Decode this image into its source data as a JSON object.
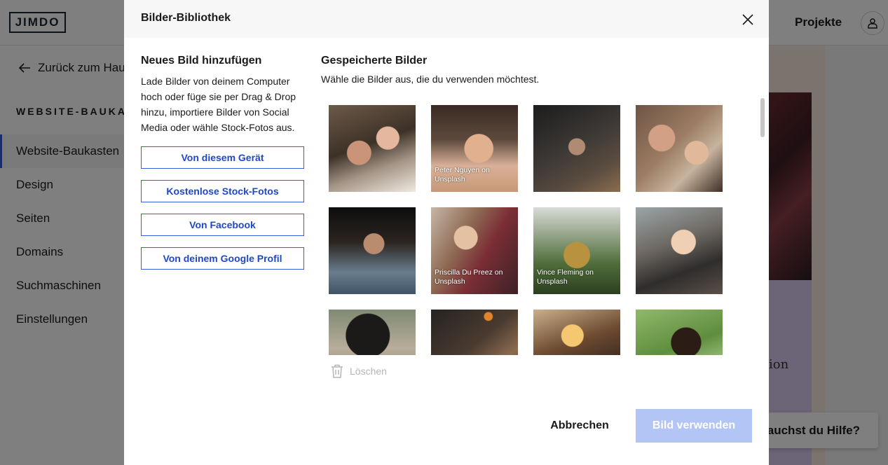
{
  "app": {
    "logo": "JIMDO",
    "nav_projekte": "Projekte"
  },
  "sidebar": {
    "back_label": "Zurück zum Hau",
    "section_title": "WEBSITE-BAUKAST",
    "items": [
      {
        "label": "Website-Baukasten",
        "active": true
      },
      {
        "label": "Design"
      },
      {
        "label": "Seiten"
      },
      {
        "label": "Domains"
      },
      {
        "label": "Suchmaschinen"
      },
      {
        "label": "Einstellungen"
      }
    ]
  },
  "background": {
    "preview_text": "ion",
    "help_label": "Brauchst du Hilfe?"
  },
  "modal": {
    "title": "Bilder-Bibliothek",
    "add": {
      "heading": "Neues Bild hinzufügen",
      "description": "Lade Bilder von deinem Computer hoch oder füge sie per Drag & Drop hinzu, importiere Bilder von Social Media oder wähle Stock-Fotos aus.",
      "buttons": [
        {
          "label": "Von diesem Gerät"
        },
        {
          "label": "Kostenlose Stock-Fotos"
        },
        {
          "label": "Von Facebook"
        },
        {
          "label": "Von deinem Google Profil"
        }
      ]
    },
    "saved": {
      "heading": "Gespeicherte Bilder",
      "subheading": "Wähle die Bilder aus, die du verwenden möchtest.",
      "images": [
        {
          "name": "couple-embrace",
          "credit": ""
        },
        {
          "name": "woman-portrait",
          "credit": "Peter Nguyen on Unsplash"
        },
        {
          "name": "woman-lying",
          "credit": ""
        },
        {
          "name": "couple-smiling",
          "credit": ""
        },
        {
          "name": "man-hands-on-head",
          "credit": ""
        },
        {
          "name": "women-holding-hands",
          "credit": "Priscilla Du Preez on Unsplash"
        },
        {
          "name": "gloved-hands-plants",
          "credit": "Vince Fleming on Unsplash"
        },
        {
          "name": "woman-laughing",
          "credit": ""
        },
        {
          "name": "woman-back-flowers",
          "credit": ""
        },
        {
          "name": "hair-braiding",
          "credit": ""
        },
        {
          "name": "hands-campfire",
          "credit": ""
        },
        {
          "name": "woman-curly-hair",
          "credit": ""
        }
      ]
    },
    "delete_label": "Löschen",
    "cancel_label": "Abbrechen",
    "use_label": "Bild verwenden"
  },
  "colors": {
    "accent": "#1f47c9",
    "disabled_button": "#b3c5f5"
  }
}
